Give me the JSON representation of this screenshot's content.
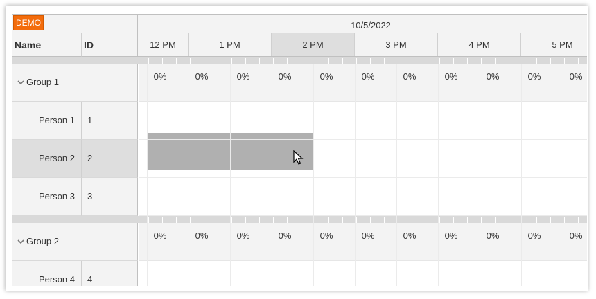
{
  "demo_badge": "DEMO",
  "date_header": "10/5/2022",
  "columns": {
    "name": "Name",
    "id": "ID"
  },
  "hours": [
    "12 PM",
    "1 PM",
    "2 PM",
    "3 PM",
    "4 PM",
    "5 PM"
  ],
  "highlighted_hour_index": 2,
  "rows": [
    {
      "type": "group",
      "name": "Group 1"
    },
    {
      "type": "resource",
      "name": "Person 1",
      "id": "1"
    },
    {
      "type": "resource",
      "name": "Person 2",
      "id": "2",
      "selected": true
    },
    {
      "type": "resource",
      "name": "Person 3",
      "id": "3"
    },
    {
      "type": "group",
      "name": "Group 2"
    },
    {
      "type": "resource",
      "name": "Person 4",
      "id": "4"
    }
  ],
  "group_percent": "0%",
  "colors": {
    "header_bg": "#f3f3f3",
    "selected_hour_bg": "#dedede",
    "group_bar": "#d9d9d9",
    "selection_block": "#b0b0b0",
    "demo_badge": "#f36c0c"
  }
}
